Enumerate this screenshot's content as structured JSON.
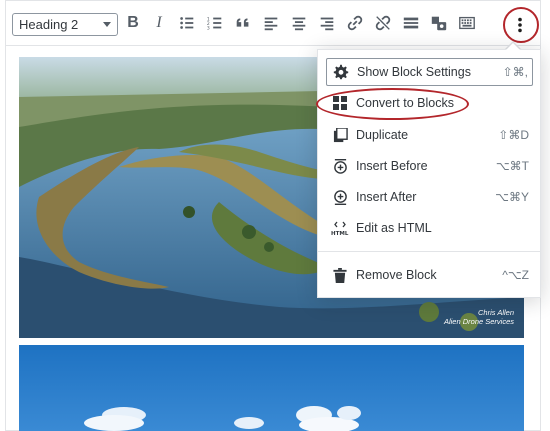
{
  "toolbar": {
    "heading_select": "Heading 2",
    "buttons": [
      {
        "name": "bold",
        "icon": "bold-icon"
      },
      {
        "name": "italic",
        "icon": "italic-icon"
      },
      {
        "name": "unordered-list",
        "icon": "list-bullets-icon"
      },
      {
        "name": "ordered-list",
        "icon": "list-numbers-icon"
      },
      {
        "name": "blockquote",
        "icon": "quote-icon"
      },
      {
        "name": "align-left",
        "icon": "align-left-icon"
      },
      {
        "name": "align-center",
        "icon": "align-center-icon"
      },
      {
        "name": "align-right",
        "icon": "align-right-icon"
      },
      {
        "name": "link",
        "icon": "link-icon"
      },
      {
        "name": "unlink",
        "icon": "unlink-icon"
      },
      {
        "name": "read-more",
        "icon": "read-more-icon"
      },
      {
        "name": "add-media",
        "icon": "media-icon"
      },
      {
        "name": "toggle-toolbar",
        "icon": "keyboard-icon"
      }
    ],
    "more_icon": "more-vertical-icon"
  },
  "images": {
    "aerial_caption_line1": "Chris Allen",
    "aerial_caption_line2": "Alien Drone Services"
  },
  "menu": {
    "items": [
      {
        "label": "Show Block Settings",
        "shortcut": "⇧⌘,",
        "icon": "gear-icon"
      },
      {
        "label": "Convert to Blocks",
        "shortcut": "",
        "icon": "blocks-icon"
      },
      {
        "label": "Duplicate",
        "shortcut": "⇧⌘D",
        "icon": "duplicate-icon"
      },
      {
        "label": "Insert Before",
        "shortcut": "⌥⌘T",
        "icon": "insert-before-icon"
      },
      {
        "label": "Insert After",
        "shortcut": "⌥⌘Y",
        "icon": "insert-after-icon"
      },
      {
        "label": "Edit as HTML",
        "shortcut": "",
        "icon": "html-icon"
      },
      {
        "label": "Remove Block",
        "shortcut": "^⌥Z",
        "icon": "trash-icon"
      }
    ]
  },
  "colors": {
    "highlight_ring": "#b3262b",
    "icon_gray": "#555d66",
    "text": "#32373c"
  }
}
